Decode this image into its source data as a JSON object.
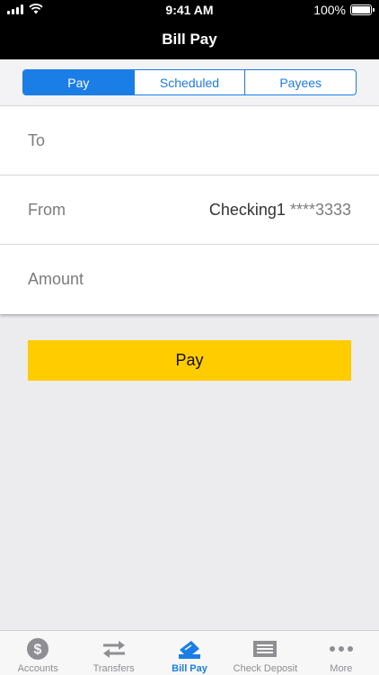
{
  "status_bar": {
    "time": "9:41 AM",
    "battery_text": "100%",
    "battery_level": 1.0
  },
  "nav": {
    "title": "Bill Pay"
  },
  "segments": [
    {
      "label": "Pay",
      "active": true
    },
    {
      "label": "Scheduled",
      "active": false
    },
    {
      "label": "Payees",
      "active": false
    }
  ],
  "form": {
    "to_label": "To",
    "from_label": "From",
    "from_account": "Checking1",
    "from_mask": "****3333",
    "amount_label": "Amount"
  },
  "pay_button": {
    "label": "Pay",
    "color": "#ffcc00"
  },
  "tabs": [
    {
      "label": "Accounts",
      "icon": "dollar-circle-icon"
    },
    {
      "label": "Transfers",
      "icon": "transfer-arrows-icon"
    },
    {
      "label": "Bill Pay",
      "icon": "bill-pay-icon",
      "active": true
    },
    {
      "label": "Check Deposit",
      "icon": "check-icon"
    },
    {
      "label": "More",
      "icon": "more-dots-icon"
    }
  ],
  "colors": {
    "accent": "#1a7ee6",
    "header_bg": "#000000",
    "background": "#ececee"
  }
}
